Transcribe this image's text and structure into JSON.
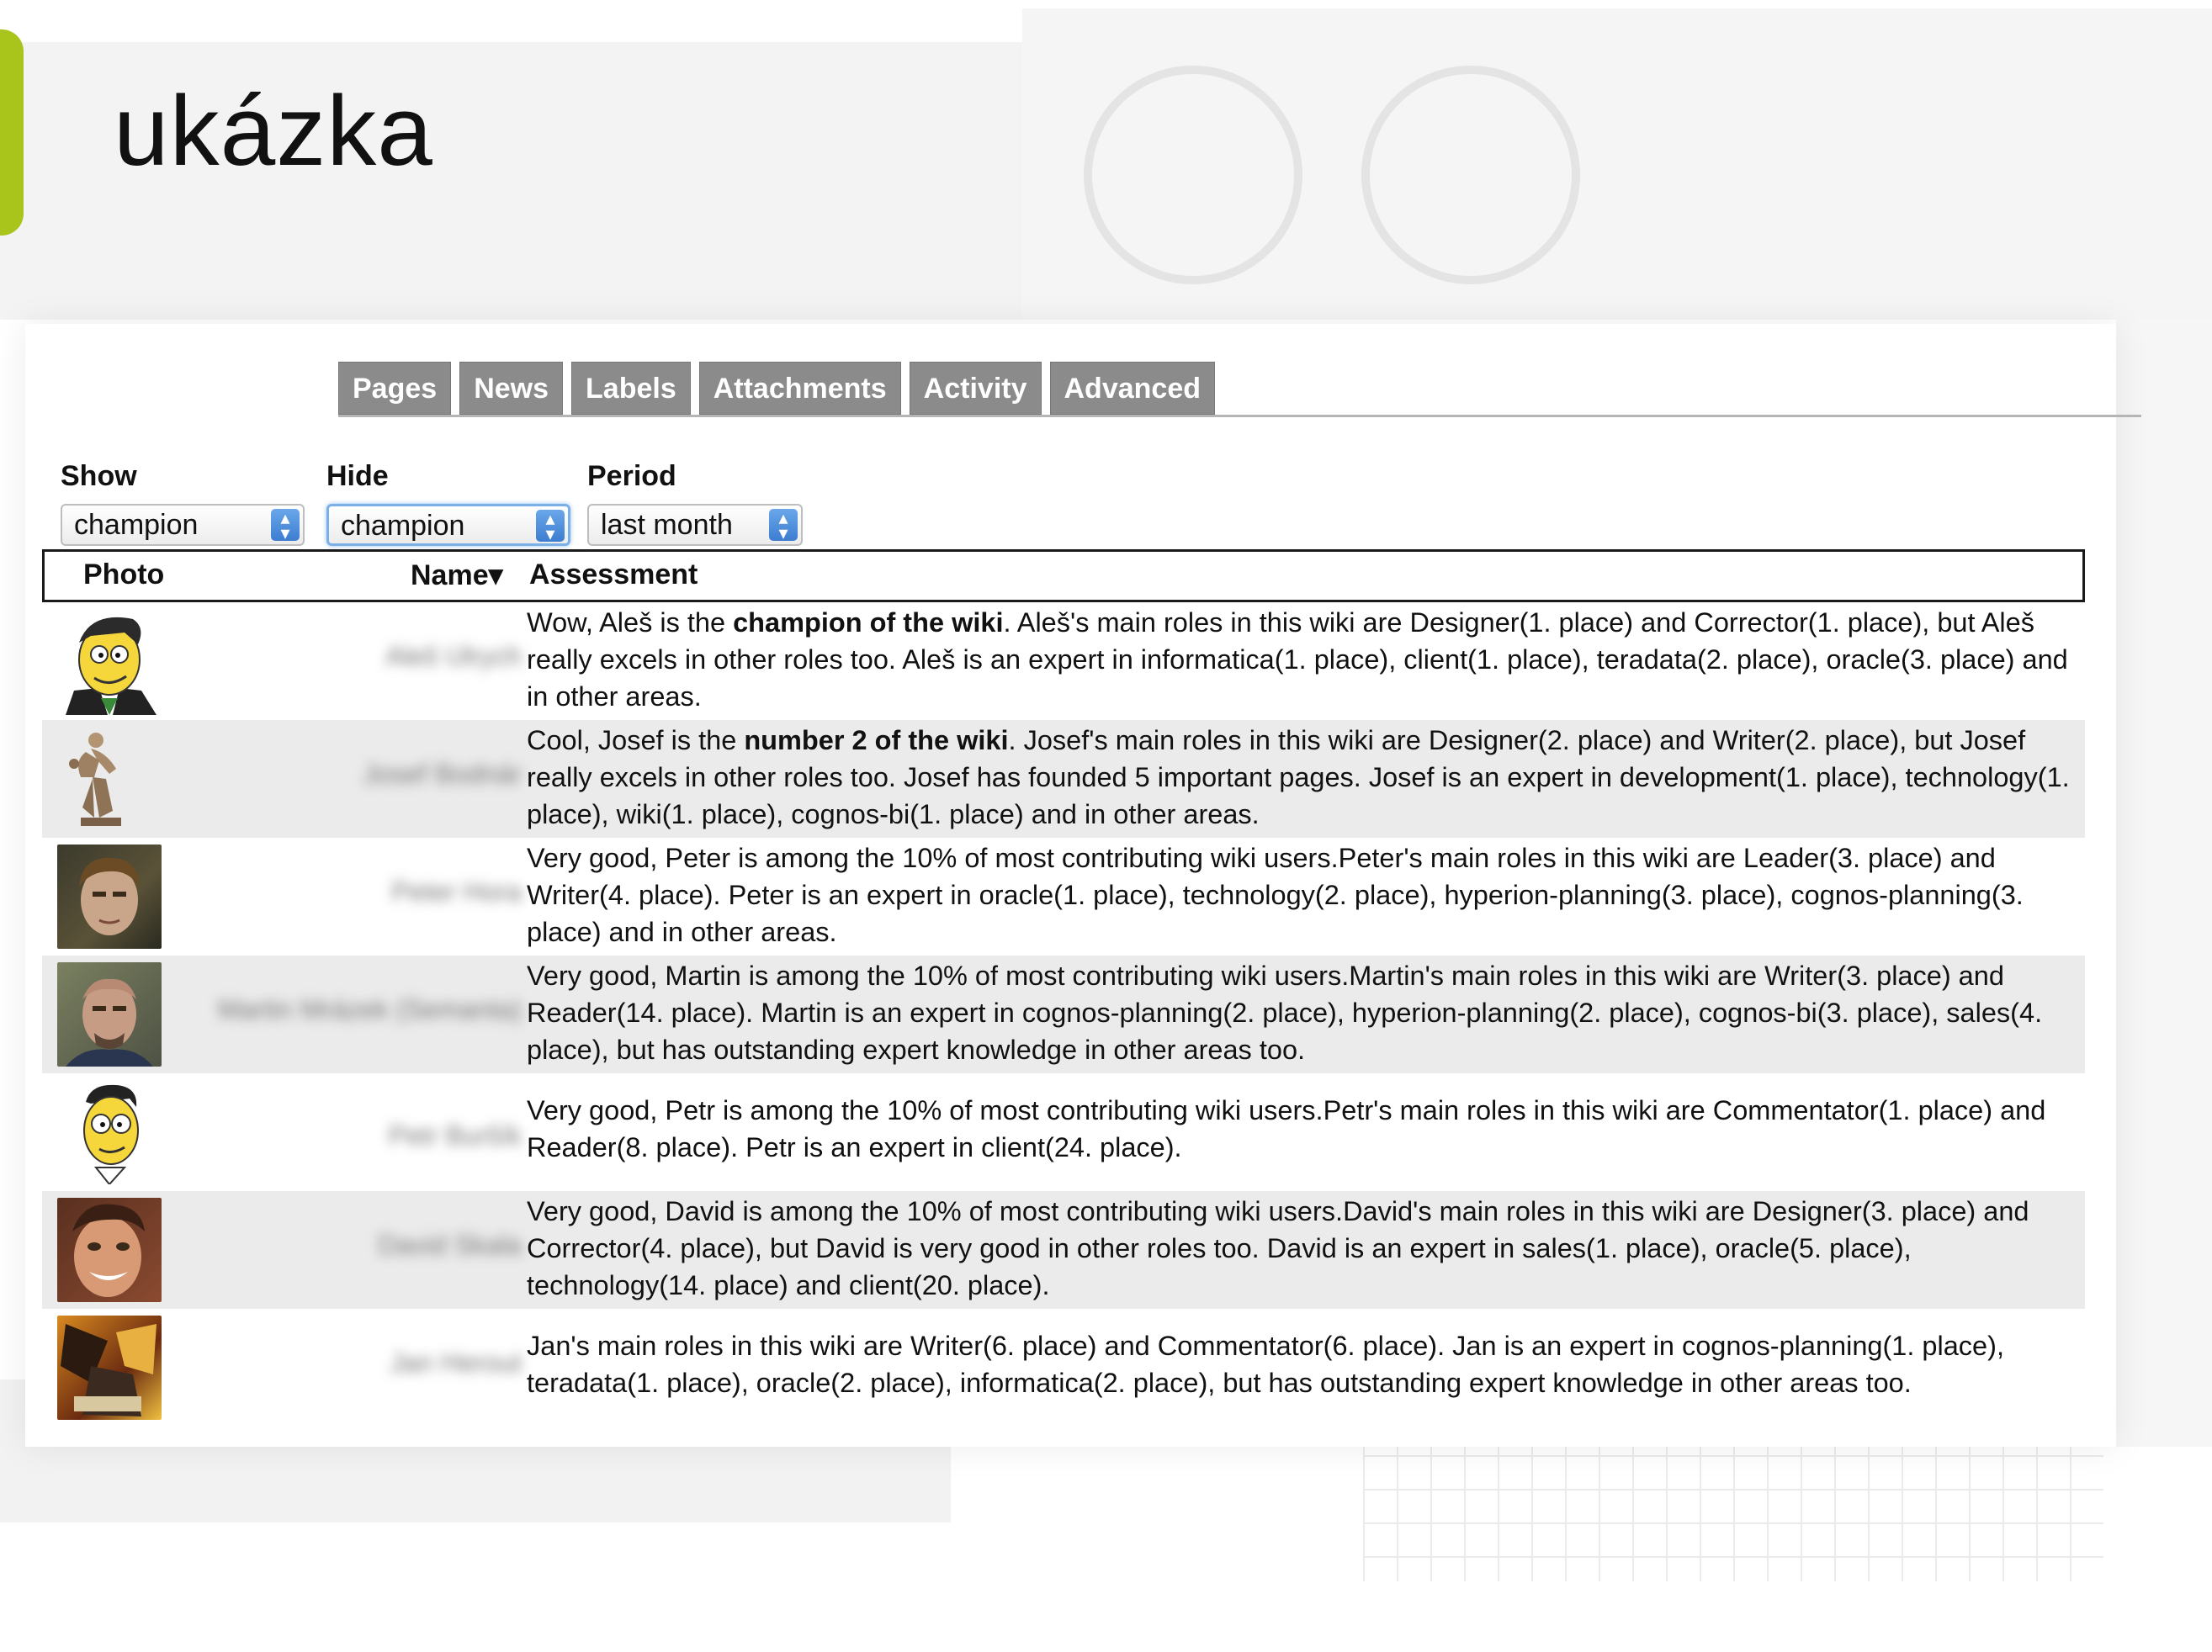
{
  "slide": {
    "title": "ukázka"
  },
  "tabs": [
    "Pages",
    "News",
    "Labels",
    "Attachments",
    "Activity",
    "Advanced"
  ],
  "filters": {
    "show": {
      "label": "Show",
      "value": "champion"
    },
    "hide": {
      "label": "Hide",
      "value": "champion"
    },
    "period": {
      "label": "Period",
      "value": "last month"
    }
  },
  "table": {
    "headers": {
      "photo": "Photo",
      "name": "Name▾",
      "assessment": "Assessment"
    },
    "rows": [
      {
        "name": "Aleš Ulrych",
        "pre": "Wow, Aleš is the ",
        "bold": "champion of the wiki",
        "post": ". Aleš's main roles in this wiki are Designer(1. place) and Corrector(1. place), but Aleš really excels in other roles too. Aleš is an expert in informatica(1. place), client(1. place), teradata(2. place), oracle(3. place) and in other areas."
      },
      {
        "name": "Josef Bodnár",
        "pre": "Cool, Josef is the ",
        "bold": "number 2 of the wiki",
        "post": ". Josef's main roles in this wiki are Designer(2. place) and Writer(2. place), but Josef really excels in other roles too. Josef has founded 5 important pages. Josef is an expert in development(1. place), technology(1. place), wiki(1. place), cognos-bi(1. place) and in other areas."
      },
      {
        "name": "Peter Hora",
        "pre": "Very good, Peter is among the 10% of most contributing wiki users.Peter's main roles in this wiki are Leader(3. place) and Writer(4. place). Peter is an expert in oracle(1. place), technology(2. place), hyperion-planning(3. place), cognos-planning(3. place) and in other areas.",
        "bold": "",
        "post": ""
      },
      {
        "name": "Martin Mrázek (Semanta)",
        "pre": "Very good, Martin is among the 10% of most contributing wiki users.Martin's main roles in this wiki are Writer(3. place) and Reader(14. place). Martin is an expert in cognos-planning(2. place), hyperion-planning(2. place), cognos-bi(3. place), sales(4. place), but has outstanding expert knowledge in other areas too.",
        "bold": "",
        "post": ""
      },
      {
        "name": "Petr Buršík",
        "pre": "Very good, Petr is among the 10% of most contributing wiki users.Petr's main roles in this wiki are Commentator(1. place) and Reader(8. place). Petr is an expert in client(24. place).",
        "bold": "",
        "post": ""
      },
      {
        "name": "David Skala",
        "pre": "Very good, David is among the 10% of most contributing wiki users.David's main roles in this wiki are Designer(3. place) and Corrector(4. place), but David is very good in other roles too. David is an expert in sales(1. place), oracle(5. place), technology(14. place) and client(20. place).",
        "bold": "",
        "post": ""
      },
      {
        "name": "Jan Herout",
        "pre": "Jan's main roles in this wiki are Writer(6. place) and Commentator(6. place). Jan is an expert in cognos-planning(1. place), teradata(1. place), oracle(2. place), informatica(2. place), but has outstanding expert knowledge in other areas too.",
        "bold": "",
        "post": ""
      }
    ]
  },
  "colors": {
    "accent": "#a9c51b",
    "tab": "#8b8b8b",
    "row_alt": "#ebebeb"
  }
}
